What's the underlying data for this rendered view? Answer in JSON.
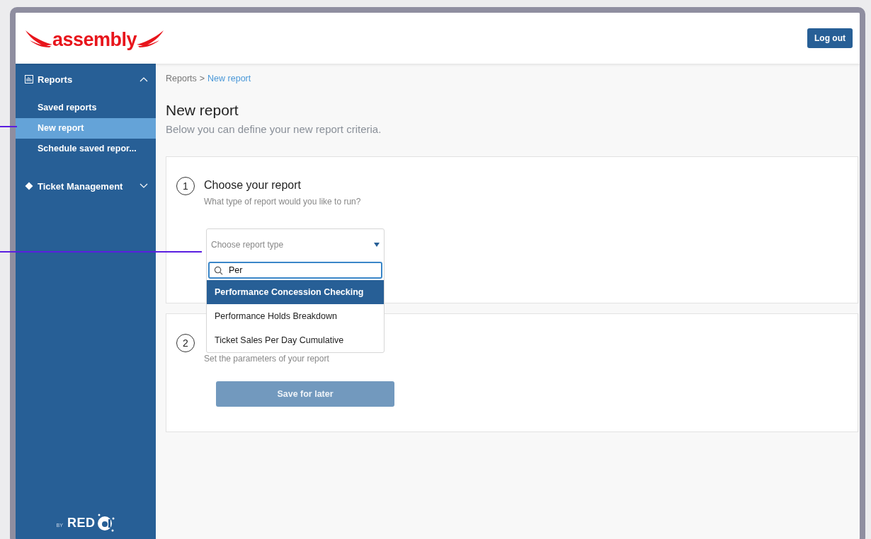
{
  "header": {
    "logo": "assembly",
    "logout": "Log out"
  },
  "sidebar": {
    "sections": [
      {
        "label": "Reports",
        "kind": "reports",
        "expanded": true,
        "items": [
          {
            "label": "Saved reports",
            "selected": false
          },
          {
            "label": "New report",
            "selected": true
          },
          {
            "label": "Schedule saved repor..."
          }
        ]
      },
      {
        "label": "Ticket Management",
        "kind": "tickets",
        "expanded": false
      }
    ],
    "footer": {
      "by": "BY",
      "brand": "RED"
    }
  },
  "breadcrumb": [
    {
      "label": "Reports",
      "current": false
    },
    {
      "label": ">",
      "current": false
    },
    {
      "label": "New report",
      "current": true
    }
  ],
  "page": {
    "title": "New report",
    "subtitle": "Below you can define your new report criteria."
  },
  "steps": [
    {
      "number": "1",
      "title": "Choose your report",
      "hint": "What type of report would you like to run?",
      "dropdown": {
        "placeholder": "Choose report type",
        "search": "Per",
        "options": [
          {
            "label": "Performance Concession Checking",
            "selected": true
          },
          {
            "label": "Performance Holds Breakdown",
            "selected": false
          },
          {
            "label": "Ticket Sales Per Day Cumulative",
            "selected": false
          }
        ]
      }
    },
    {
      "number": "2",
      "hint": "Set the parameters of your report",
      "button": {
        "label": "Save for later",
        "disabled": true
      }
    }
  ]
}
